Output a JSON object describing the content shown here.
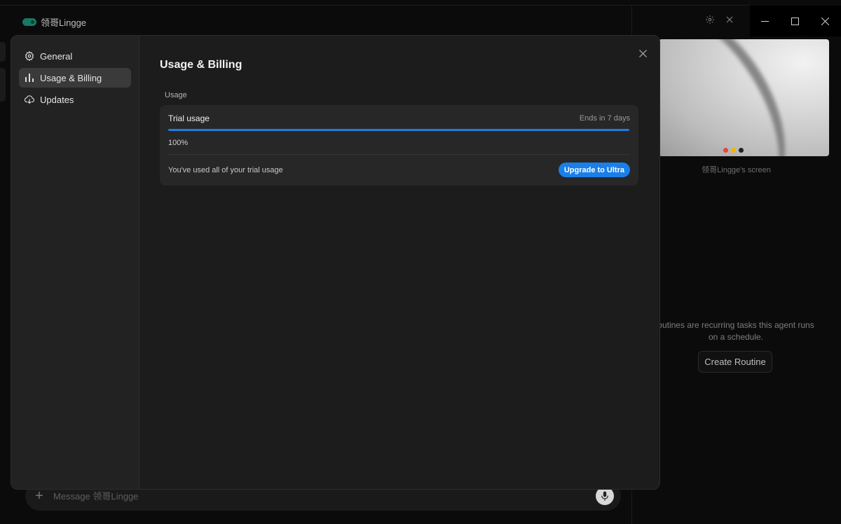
{
  "app": {
    "title": "领哥Lingge",
    "message_placeholder": "Message 领哥Lingge",
    "colors": {
      "accent": "#1a7fe8",
      "logo": "#167a64"
    }
  },
  "right_panel": {
    "screen_caption": "领哥Lingge's screen",
    "routines_text": "outines are recurring tasks this agent runs on a schedule.",
    "create_routine_label": "Create Routine"
  },
  "settings": {
    "sidebar": {
      "items": [
        {
          "label": "General",
          "icon": "gear-icon",
          "active": false
        },
        {
          "label": "Usage & Billing",
          "icon": "bar-chart-icon",
          "active": true
        },
        {
          "label": "Updates",
          "icon": "cloud-download-icon",
          "active": false
        }
      ]
    },
    "title": "Usage & Billing",
    "usage": {
      "section_label": "Usage",
      "card_title": "Trial usage",
      "ends_text": "Ends in 7 days",
      "progress_percent": 100,
      "progress_label": "100%",
      "footer_text": "You've used all of your trial usage",
      "upgrade_label": "Upgrade to Ultra"
    }
  }
}
